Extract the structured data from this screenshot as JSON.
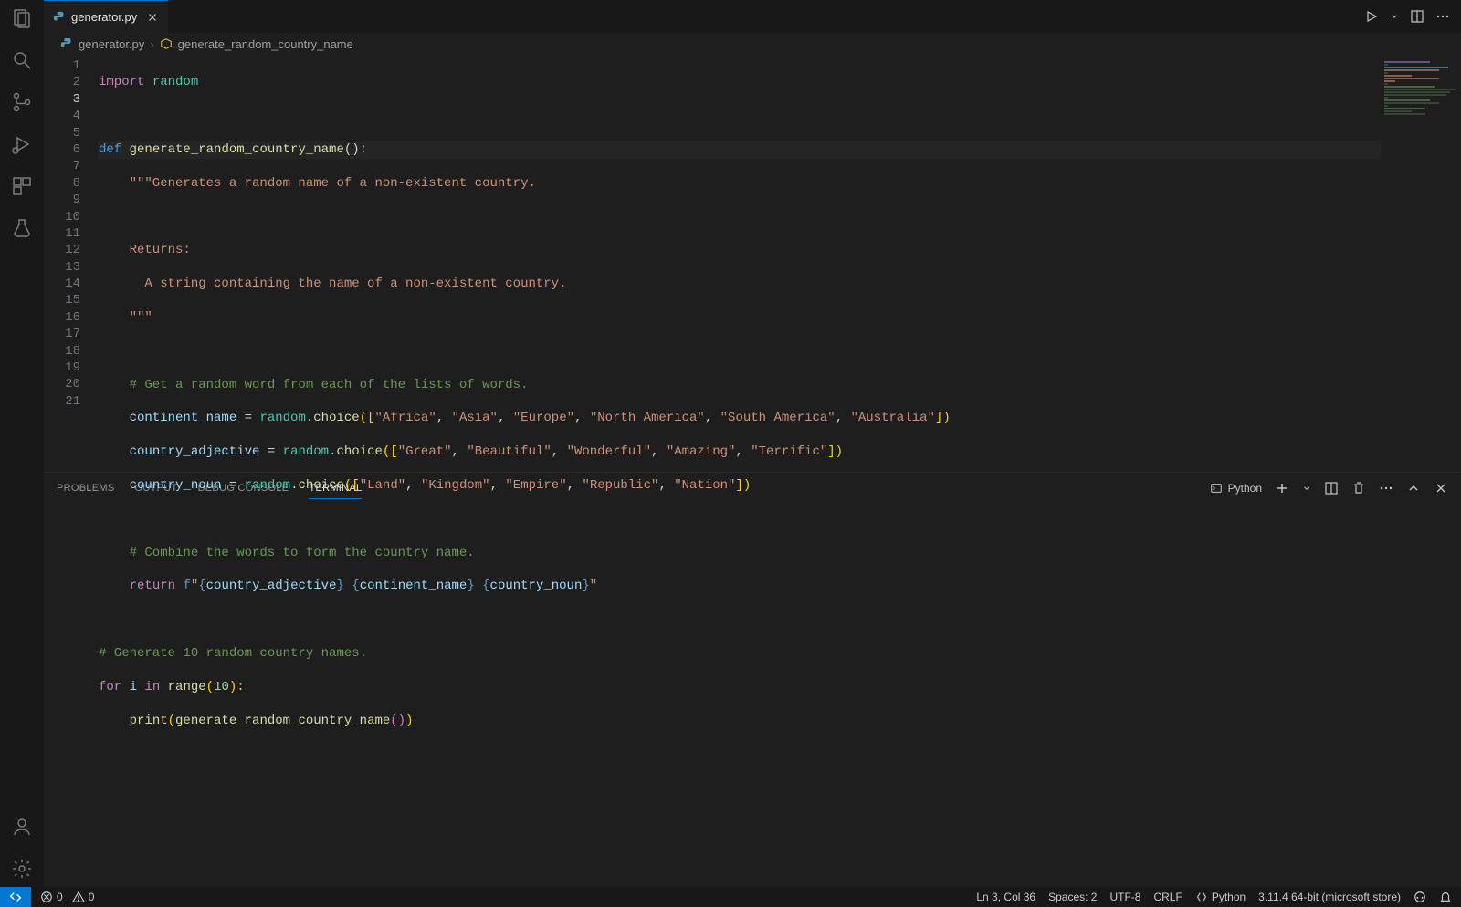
{
  "tab": {
    "filename": "generator.py"
  },
  "breadcrumb": {
    "file": "generator.py",
    "symbol": "generate_random_country_name"
  },
  "line_numbers": [
    "1",
    "2",
    "3",
    "4",
    "5",
    "6",
    "7",
    "8",
    "9",
    "10",
    "11",
    "12",
    "13",
    "14",
    "15",
    "16",
    "17",
    "18",
    "19",
    "20",
    "21"
  ],
  "current_line_idx": 2,
  "code": {
    "l1": {
      "import": "import",
      "module": "random"
    },
    "l3": {
      "def": "def",
      "name": "generate_random_country_name",
      "paren": "():"
    },
    "l4": {
      "s": "    \"\"\"Generates a random name of a non-existent country."
    },
    "l6": {
      "s": "    Returns:"
    },
    "l7": {
      "s": "      A string containing the name of a non-existent country."
    },
    "l8": {
      "s": "    \"\"\""
    },
    "l10": {
      "s": "    # Get a random word from each of the lists of words."
    },
    "l11": {
      "var": "continent_name",
      "assign": " = ",
      "mod": "random",
      "dot": ".",
      "fn": "choice",
      "open": "([",
      "s1": "\"Africa\"",
      "c1": ", ",
      "s2": "\"Asia\"",
      "c2": ", ",
      "s3": "\"Europe\"",
      "c3": ", ",
      "s4": "\"North America\"",
      "c4": ", ",
      "s5": "\"South America\"",
      "c5": ", ",
      "s6": "\"Australia\"",
      "close": "])"
    },
    "l12": {
      "var": "country_adjective",
      "assign": " = ",
      "mod": "random",
      "dot": ".",
      "fn": "choice",
      "open": "([",
      "s1": "\"Great\"",
      "c1": ", ",
      "s2": "\"Beautiful\"",
      "c2": ", ",
      "s3": "\"Wonderful\"",
      "c3": ", ",
      "s4": "\"Amazing\"",
      "c4": ", ",
      "s5": "\"Terrific\"",
      "close": "])"
    },
    "l13": {
      "var": "country_noun",
      "assign": " = ",
      "mod": "random",
      "dot": ".",
      "fn": "choice",
      "open": "([",
      "s1": "\"Land\"",
      "c1": ", ",
      "s2": "\"Kingdom\"",
      "c2": ", ",
      "s3": "\"Empire\"",
      "c3": ", ",
      "s4": "\"Republic\"",
      "c4": ", ",
      "s5": "\"Nation\"",
      "close": "])"
    },
    "l15": {
      "s": "    # Combine the words to form the country name."
    },
    "l16": {
      "ret": "return",
      "sp": " ",
      "f": "f",
      "q": "\"",
      "b": "{",
      "v1": "country_adjective",
      "e": "}",
      "sp2": " ",
      "b2": "{",
      "v2": "continent_name",
      "e2": "}",
      "sp3": " ",
      "b3": "{",
      "v3": "country_noun",
      "e3": "}",
      "q2": "\""
    },
    "l18": {
      "s": "# Generate 10 random country names."
    },
    "l19": {
      "for": "for",
      "sp": " ",
      "i": "i",
      "sp2": " ",
      "in": "in",
      "sp3": " ",
      "range": "range",
      "open": "(",
      "n": "10",
      "close": "):"
    },
    "l20": {
      "indent": "    ",
      "print": "print",
      "open": "(",
      "fn": "generate_random_country_name",
      "p": "()",
      ")": ")"
    }
  },
  "panel": {
    "tabs": {
      "problems": "PROBLEMS",
      "output": "OUTPUT",
      "debug": "DEBUG CONSOLE",
      "terminal": "TERMINAL"
    },
    "terminal_kind": "Python"
  },
  "status": {
    "errors": "0",
    "warnings": "0",
    "ln": "Ln 3, Col 36",
    "spaces": "Spaces: 2",
    "encoding": "UTF-8",
    "eol": "CRLF",
    "lang": "Python",
    "interpreter": "3.11.4 64-bit (microsoft store)"
  }
}
